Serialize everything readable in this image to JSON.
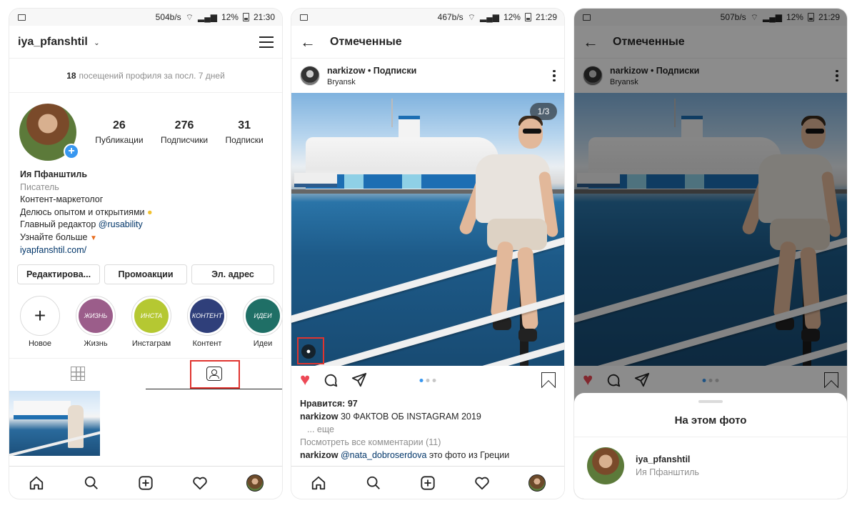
{
  "screen1": {
    "status": {
      "speed": "504b/s",
      "battery": "12%",
      "time": "21:30"
    },
    "username": "iya_pfanshtil",
    "visits_count": "18",
    "visits_text": "посещений профиля за посл. 7 дней",
    "stats": [
      {
        "value": "26",
        "label": "Публикации"
      },
      {
        "value": "276",
        "label": "Подписчики"
      },
      {
        "value": "31",
        "label": "Подписки"
      }
    ],
    "bio": {
      "name": "Ия Пфанштиль",
      "category": "Писатель",
      "line1": "Контент-маркетолог",
      "line2": "Делюсь опытом и открытиями",
      "line3_prefix": "Главный редактор",
      "line3_mention": "@rusability",
      "line4": "Узнайте больше",
      "link": "iyapfanshtil.com/"
    },
    "buttons": [
      "Редактирова...",
      "Промоакции",
      "Эл. адрес"
    ],
    "highlights": [
      {
        "label": "Новое",
        "inner": "+",
        "color": "#ffffff"
      },
      {
        "label": "Жизнь",
        "inner": "ЖИЗНЬ",
        "color": "#9b5d8a"
      },
      {
        "label": "Инстаграм",
        "inner": "ИНСТА",
        "color": "#b5c832"
      },
      {
        "label": "Контент",
        "inner": "КОНТЕНТ",
        "color": "#2f3f7a"
      },
      {
        "label": "Идеи",
        "inner": "ИДЕИ",
        "color": "#1f6f66"
      }
    ]
  },
  "screen2": {
    "status": {
      "speed": "467b/s",
      "battery": "12%",
      "time": "21:29"
    },
    "title": "Отмеченные",
    "post_user": "narkizow • Подписки",
    "location": "Bryansk",
    "counter": "1/3",
    "likes": "Нравится: 97",
    "caption_user": "narkizow",
    "caption_text": "⁣​30 ФАКТОВ ОБ INSTAGRAM 2019",
    "more": "... еще",
    "view_comments": "Посмотреть все комментарии (11)",
    "comment_user": "narkizow",
    "comment_mention": "@nata_dobroserdova",
    "comment_text": "это фото из Греции"
  },
  "screen3": {
    "status": {
      "speed": "507b/s",
      "battery": "12%",
      "time": "21:29"
    },
    "title": "Отмеченные",
    "post_user": "narkizow • Подписки",
    "location": "Bryansk",
    "sheet_title": "На этом фото",
    "tagged_username": "iya_pfanshtil",
    "tagged_name": "Ия Пфанштиль"
  },
  "colors": {
    "accent": "#3897f0",
    "like": "#ed4956",
    "highlight_box": "#e0342f"
  }
}
